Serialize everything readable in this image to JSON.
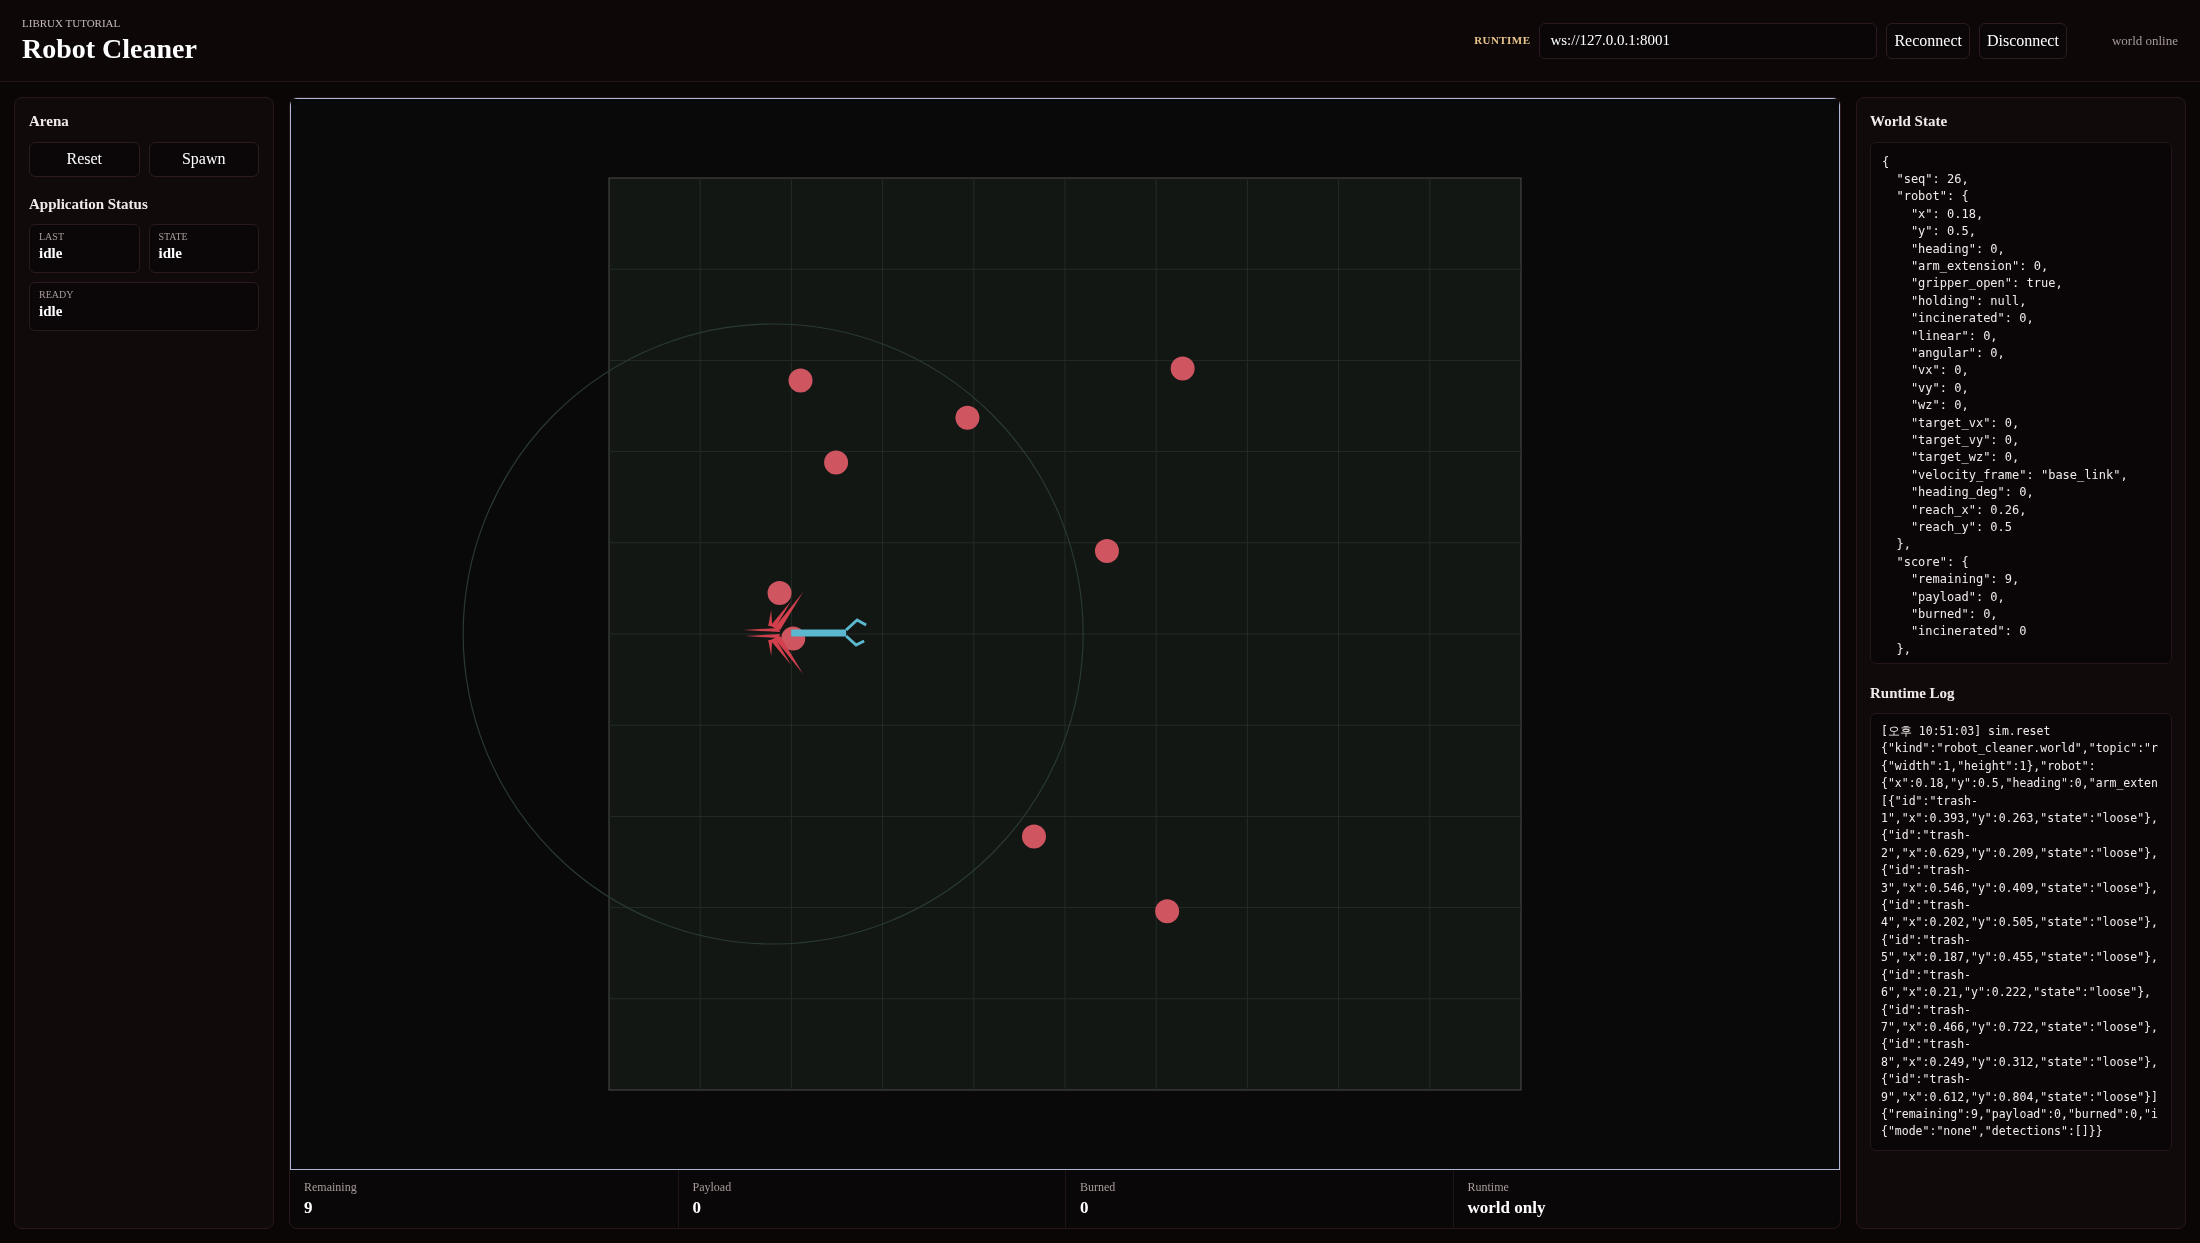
{
  "header": {
    "eyebrow": "LIBRUX TUTORIAL",
    "title": "Robot Cleaner",
    "runtime_label": "RUNTIME",
    "url_field": {
      "value": "ws://127.0.0.1:8001"
    },
    "buttons": [
      "Reconnect",
      "Disconnect"
    ],
    "connection_status": "world online"
  },
  "sidebar": {
    "arena": {
      "title": "Arena",
      "buttons": [
        "Reset",
        "Spawn"
      ]
    },
    "application_status": {
      "title": "Application Status",
      "cards": [
        {
          "label": "LAST",
          "value": "idle"
        },
        {
          "label": "STATE",
          "value": "idle"
        },
        {
          "label": "READY",
          "value": "idle"
        }
      ]
    }
  },
  "stats": [
    {
      "label": "Remaining",
      "value": "9"
    },
    {
      "label": "Payload",
      "value": "0"
    },
    {
      "label": "Burned",
      "value": "0"
    },
    {
      "label": "Runtime",
      "value": "world only"
    }
  ],
  "world_state": {
    "title": "World State",
    "lines": [
      "{",
      "  \"seq\": 26,",
      "  \"robot\": {",
      "    \"x\": 0.18,",
      "    \"y\": 0.5,",
      "    \"heading\": 0,",
      "    \"arm_extension\": 0,",
      "    \"gripper_open\": true,",
      "    \"holding\": null,",
      "    \"incinerated\": 0,",
      "    \"linear\": 0,",
      "    \"angular\": 0,",
      "    \"vx\": 0,",
      "    \"vy\": 0,",
      "    \"wz\": 0,",
      "    \"target_vx\": 0,",
      "    \"target_vy\": 0,",
      "    \"target_wz\": 0,",
      "    \"velocity_frame\": \"base_link\",",
      "    \"heading_deg\": 0,",
      "    \"reach_x\": 0.26,",
      "    \"reach_y\": 0.5",
      "  },",
      "  \"score\": {",
      "    \"remaining\": 9,",
      "    \"payload\": 0,",
      "    \"burned\": 0,",
      "    \"incinerated\": 0",
      "  },"
    ]
  },
  "runtime_log": {
    "title": "Runtime Log",
    "lines": [
      "[오후 10:51:03] sim.reset",
      "{\"kind\":\"robot_cleaner.world\",\"topic\":\"r",
      "{\"width\":1,\"height\":1},\"robot\":",
      "{\"x\":0.18,\"y\":0.5,\"heading\":0,\"arm_exten",
      "[{\"id\":\"trash-",
      "1\",\"x\":0.393,\"y\":0.263,\"state\":\"loose\"},",
      "{\"id\":\"trash-",
      "2\",\"x\":0.629,\"y\":0.209,\"state\":\"loose\"},",
      "{\"id\":\"trash-",
      "3\",\"x\":0.546,\"y\":0.409,\"state\":\"loose\"},",
      "{\"id\":\"trash-",
      "4\",\"x\":0.202,\"y\":0.505,\"state\":\"loose\"},",
      "{\"id\":\"trash-",
      "5\",\"x\":0.187,\"y\":0.455,\"state\":\"loose\"},",
      "{\"id\":\"trash-",
      "6\",\"x\":0.21,\"y\":0.222,\"state\":\"loose\"},",
      "{\"id\":\"trash-",
      "7\",\"x\":0.466,\"y\":0.722,\"state\":\"loose\"},",
      "{\"id\":\"trash-",
      "8\",\"x\":0.249,\"y\":0.312,\"state\":\"loose\"},",
      "{\"id\":\"trash-",
      "9\",\"x\":0.612,\"y\":0.804,\"state\":\"loose\"}]",
      "{\"remaining\":9,\"payload\":0,\"burned\":0,\"i",
      "{\"mode\":\"none\",\"detections\":[]}}"
    ]
  }
}
